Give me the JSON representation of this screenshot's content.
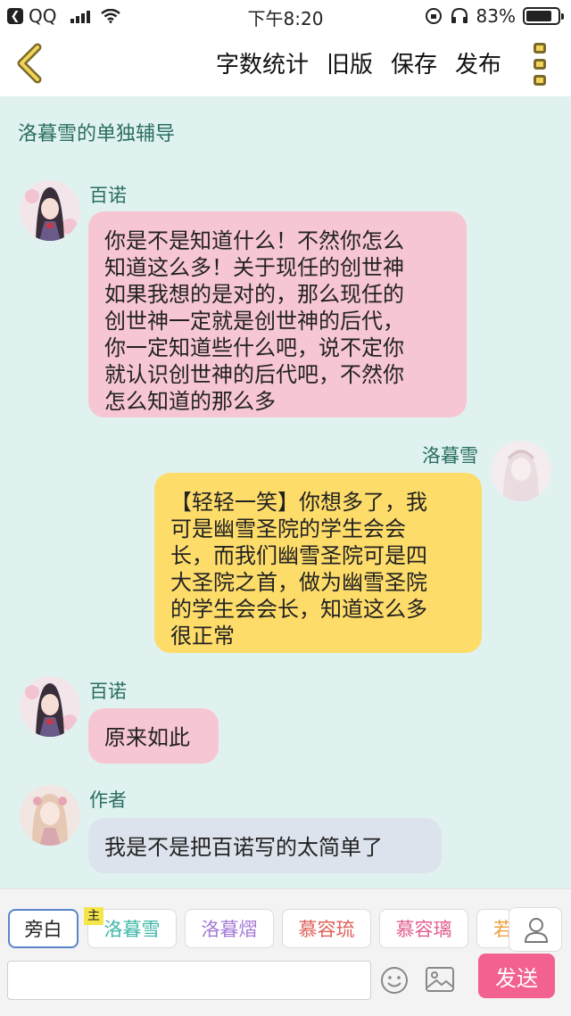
{
  "status_bar": {
    "carrier": "QQ",
    "time": "下午8:20",
    "battery": "83%",
    "battery_level": 0.83
  },
  "header": {
    "actions": [
      "字数统计",
      "旧版",
      "保存",
      "发布"
    ]
  },
  "chat_title": "洛暮雪的单独辅导",
  "messages": [
    {
      "sender": "百诺",
      "text": "你是不是知道什么！不然你怎么\n知道这么多！关于现任的创世神\n如果我想的是对的，那么现任的\n创世神一定就是创世神的后代，\n你一定知道些什么吧，说不定你\n就认识创世神的后代吧，不然你\n怎么知道的那么多"
    },
    {
      "sender": "洛暮雪",
      "text": "【轻轻一笑】你想多了，我\n可是幽雪圣院的学生会会\n长，而我们幽雪圣院可是四\n大圣院之首，做为幽雪圣院\n的学生会会长，知道这么多\n很正常"
    },
    {
      "sender": "百诺",
      "text": "原来如此"
    },
    {
      "sender": "作者",
      "text": "我是不是把百诺写的太简单了"
    }
  ],
  "roles": {
    "master_badge": "主",
    "items": [
      {
        "label": "旁白",
        "color": "#222222"
      },
      {
        "label": "洛暮雪",
        "color": "#3fb8a8"
      },
      {
        "label": "洛暮熠",
        "color": "#a57ad6"
      },
      {
        "label": "慕容琉",
        "color": "#e0615a"
      },
      {
        "label": "慕容璃",
        "color": "#e25f93"
      },
      {
        "label": "若",
        "color": "#f0a040"
      }
    ]
  },
  "composer": {
    "input_value": "",
    "send_label": "发送"
  },
  "colors": {
    "accent": "#2a6e62",
    "send": "#f2618f",
    "pink_bubble": "#f7c6d3",
    "yellow_bubble": "#fddc6a",
    "grey_bubble": "#dde3ec"
  }
}
